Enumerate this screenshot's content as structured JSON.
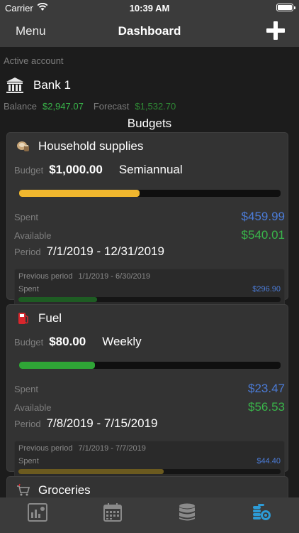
{
  "status": {
    "carrier": "Carrier",
    "time": "10:39 AM"
  },
  "nav": {
    "menu_label": "Menu",
    "title": "Dashboard"
  },
  "account": {
    "label": "Active account",
    "bank_name": "Bank 1",
    "balance_label": "Balance",
    "balance_value": "$2,947.07",
    "forecast_label": "Forecast",
    "forecast_value": "$1,532.70"
  },
  "section_title": "Budgets",
  "budgets": [
    {
      "name": "Household supplies",
      "icon": "household-supplies-icon",
      "budget_label": "Budget",
      "amount": "$1,000.00",
      "frequency": "Semiannual",
      "progress": 0.46,
      "bar_color": "#f0b72e",
      "spent_label": "Spent",
      "spent": "$459.99",
      "available_label": "Available",
      "available": "$540.01",
      "period_label": "Period",
      "period": "7/1/2019 - 12/31/2019",
      "previous": {
        "label": "Previous period",
        "range": "1/1/2019 - 6/30/2019",
        "spent_label": "Spent",
        "spent": "$296.90",
        "progress": 0.3,
        "bar_color": "#1e5c23"
      }
    },
    {
      "name": "Fuel",
      "icon": "fuel-pump-icon",
      "budget_label": "Budget",
      "amount": "$80.00",
      "frequency": "Weekly",
      "progress": 0.29,
      "bar_color": "#2fa536",
      "spent_label": "Spent",
      "spent": "$23.47",
      "available_label": "Available",
      "available": "$56.53",
      "period_label": "Period",
      "period": "7/8/2019 - 7/15/2019",
      "previous": {
        "label": "Previous period",
        "range": "7/1/2019 - 7/7/2019",
        "spent_label": "Spent",
        "spent": "$44.40",
        "progress": 0.555,
        "bar_color": "#6b5a1f"
      }
    },
    {
      "name": "Groceries",
      "icon": "shopping-cart-icon"
    }
  ],
  "tabs": [
    {
      "name": "reports-tab",
      "icon": "report-chart-icon",
      "active": false
    },
    {
      "name": "calendar-tab",
      "icon": "calendar-icon",
      "active": false
    },
    {
      "name": "accounts-tab",
      "icon": "database-icon",
      "active": false
    },
    {
      "name": "budgets-tab",
      "icon": "coins-icon",
      "active": true
    }
  ],
  "colors": {
    "accent": "#2d9bd6",
    "inactive": "#8a8a8a"
  }
}
